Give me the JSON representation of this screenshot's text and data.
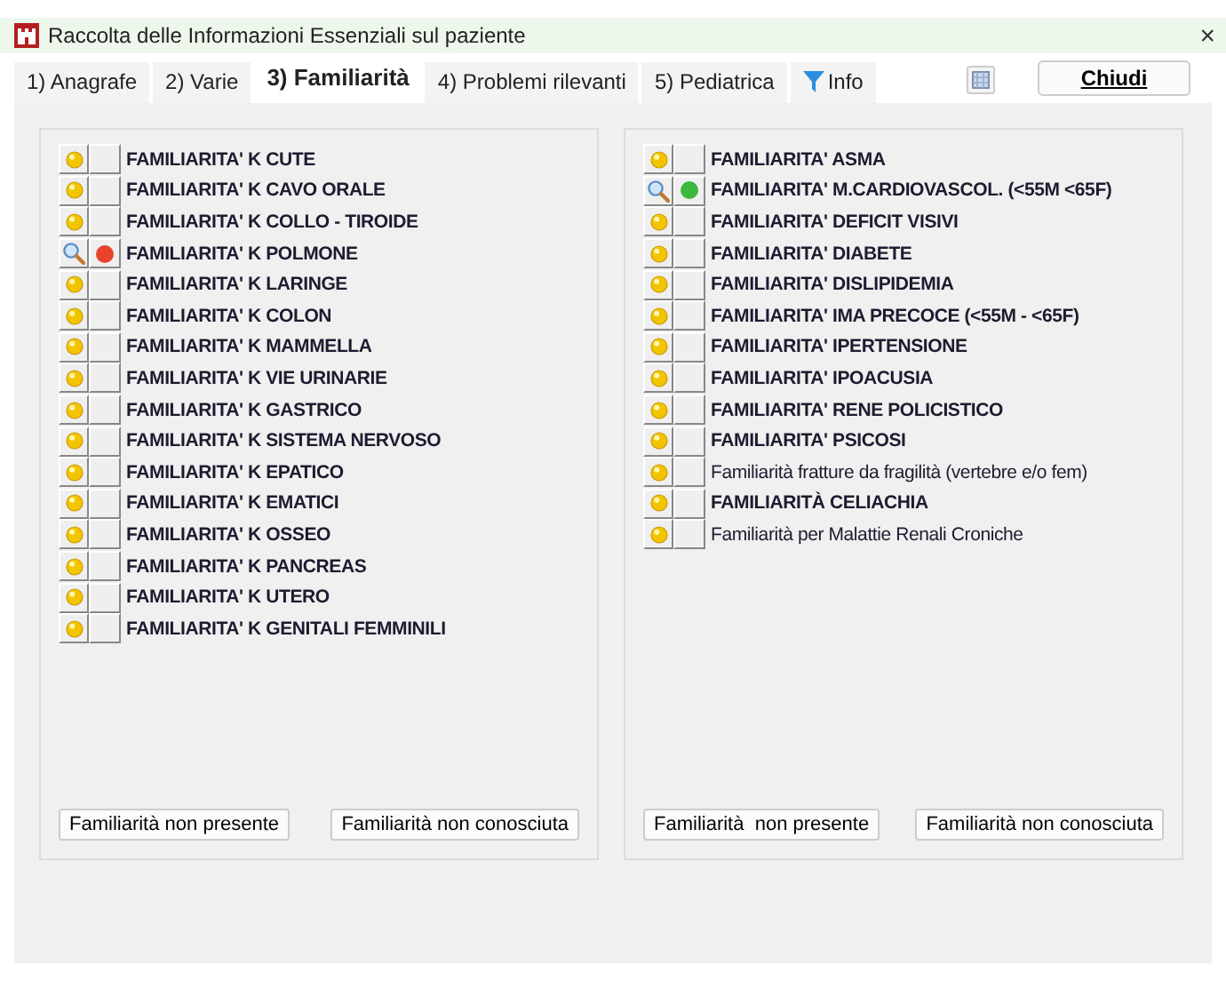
{
  "window": {
    "title": "Raccolta delle Informazioni Essenziali sul paziente",
    "close": "×"
  },
  "tabs": [
    {
      "label": "1) Anagrafe",
      "selected": false
    },
    {
      "label": "2) Varie",
      "selected": false
    },
    {
      "label": "3) Familiarità",
      "selected": true
    },
    {
      "label": "4) Problemi rilevanti",
      "selected": false
    },
    {
      "label": "5) Pediatrica",
      "selected": false
    },
    {
      "label": "Info",
      "selected": false,
      "kind": "filter"
    }
  ],
  "close_button": "Chiudi",
  "panels": [
    {
      "items": [
        {
          "label": "FAMILIARITA' K CUTE",
          "kind": "pending",
          "bold": true
        },
        {
          "label": "FAMILIARITA' K CAVO ORALE",
          "kind": "pending",
          "bold": true
        },
        {
          "label": "FAMILIARITA' K COLLO - TIROIDE",
          "kind": "pending",
          "bold": true
        },
        {
          "label": "FAMILIARITA' K POLMONE",
          "kind": "detail",
          "color": "#e8432b",
          "bold": true
        },
        {
          "label": "FAMILIARITA' K LARINGE",
          "kind": "pending",
          "bold": true
        },
        {
          "label": "FAMILIARITA' K COLON",
          "kind": "pending",
          "bold": true
        },
        {
          "label": "FAMILIARITA' K MAMMELLA",
          "kind": "pending",
          "bold": true
        },
        {
          "label": "FAMILIARITA' K VIE URINARIE",
          "kind": "pending",
          "bold": true
        },
        {
          "label": "FAMILIARITA' K GASTRICO",
          "kind": "pending",
          "bold": true
        },
        {
          "label": "FAMILIARITA' K SISTEMA NERVOSO",
          "kind": "pending",
          "bold": true
        },
        {
          "label": "FAMILIARITA' K EPATICO",
          "kind": "pending",
          "bold": true
        },
        {
          "label": "FAMILIARITA' K EMATICI",
          "kind": "pending",
          "bold": true
        },
        {
          "label": "FAMILIARITA' K OSSEO",
          "kind": "pending",
          "bold": true
        },
        {
          "label": "FAMILIARITA' K PANCREAS",
          "kind": "pending",
          "bold": true
        },
        {
          "label": "FAMILIARITA' K UTERO",
          "kind": "pending",
          "bold": true
        },
        {
          "label": "FAMILIARITA' K GENITALI FEMMINILI",
          "kind": "pending",
          "bold": true
        }
      ],
      "buttons": [
        "Familiarità non presente",
        "Familiarità non conosciuta"
      ]
    },
    {
      "items": [
        {
          "label": "FAMILIARITA' ASMA",
          "kind": "pending",
          "bold": true
        },
        {
          "label": "FAMILIARITA' M.CARDIOVASCOL. (<55M <65F)",
          "kind": "detail",
          "color": "#3cb83c",
          "bold": true
        },
        {
          "label": "FAMILIARITA' DEFICIT VISIVI",
          "kind": "pending",
          "bold": true
        },
        {
          "label": "FAMILIARITA' DIABETE",
          "kind": "pending",
          "bold": true
        },
        {
          "label": "FAMILIARITA' DISLIPIDEMIA",
          "kind": "pending",
          "bold": true
        },
        {
          "label": "FAMILIARITA' IMA PRECOCE (<55M - <65F)",
          "kind": "pending",
          "bold": true
        },
        {
          "label": "FAMILIARITA' IPERTENSIONE",
          "kind": "pending",
          "bold": true
        },
        {
          "label": "FAMILIARITA' IPOACUSIA",
          "kind": "pending",
          "bold": true
        },
        {
          "label": "FAMILIARITA' RENE POLICISTICO",
          "kind": "pending",
          "bold": true
        },
        {
          "label": "FAMILIARITA' PSICOSI",
          "kind": "pending",
          "bold": true
        },
        {
          "label": "Familiarità fratture da fragilità (vertebre e/o fem)",
          "kind": "pending",
          "bold": false
        },
        {
          "label": "FAMILIARITÀ CELIACHIA",
          "kind": "pending",
          "bold": true
        },
        {
          "label": "Familiarità per Malattie Renali Croniche",
          "kind": "pending",
          "bold": false
        }
      ],
      "buttons": [
        "Familiarità  non presente",
        "Familiarità non conosciuta"
      ]
    }
  ]
}
